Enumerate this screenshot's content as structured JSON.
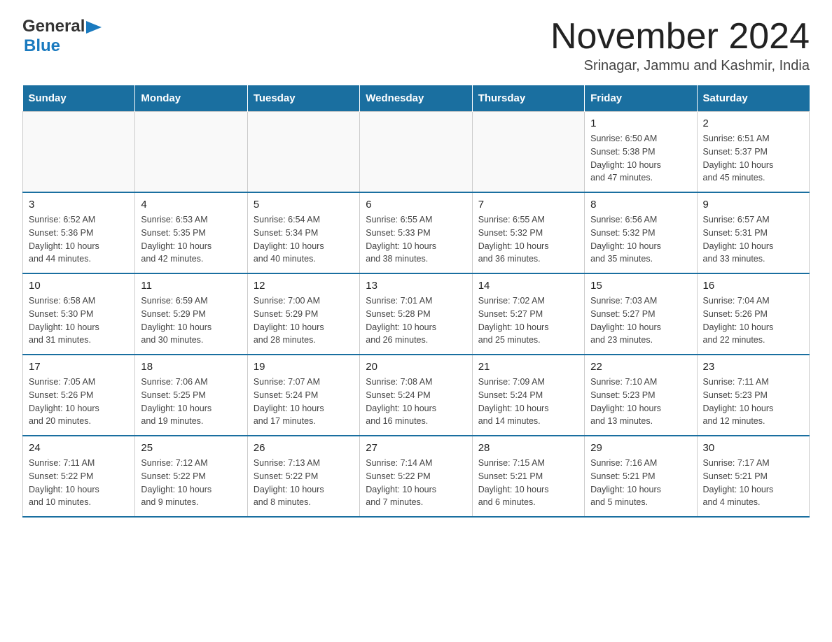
{
  "logo": {
    "general": "General",
    "triangle": "▶",
    "blue": "Blue"
  },
  "title": "November 2024",
  "location": "Srinagar, Jammu and Kashmir, India",
  "header_days": [
    "Sunday",
    "Monday",
    "Tuesday",
    "Wednesday",
    "Thursday",
    "Friday",
    "Saturday"
  ],
  "weeks": [
    [
      {
        "day": "",
        "info": ""
      },
      {
        "day": "",
        "info": ""
      },
      {
        "day": "",
        "info": ""
      },
      {
        "day": "",
        "info": ""
      },
      {
        "day": "",
        "info": ""
      },
      {
        "day": "1",
        "info": "Sunrise: 6:50 AM\nSunset: 5:38 PM\nDaylight: 10 hours\nand 47 minutes."
      },
      {
        "day": "2",
        "info": "Sunrise: 6:51 AM\nSunset: 5:37 PM\nDaylight: 10 hours\nand 45 minutes."
      }
    ],
    [
      {
        "day": "3",
        "info": "Sunrise: 6:52 AM\nSunset: 5:36 PM\nDaylight: 10 hours\nand 44 minutes."
      },
      {
        "day": "4",
        "info": "Sunrise: 6:53 AM\nSunset: 5:35 PM\nDaylight: 10 hours\nand 42 minutes."
      },
      {
        "day": "5",
        "info": "Sunrise: 6:54 AM\nSunset: 5:34 PM\nDaylight: 10 hours\nand 40 minutes."
      },
      {
        "day": "6",
        "info": "Sunrise: 6:55 AM\nSunset: 5:33 PM\nDaylight: 10 hours\nand 38 minutes."
      },
      {
        "day": "7",
        "info": "Sunrise: 6:55 AM\nSunset: 5:32 PM\nDaylight: 10 hours\nand 36 minutes."
      },
      {
        "day": "8",
        "info": "Sunrise: 6:56 AM\nSunset: 5:32 PM\nDaylight: 10 hours\nand 35 minutes."
      },
      {
        "day": "9",
        "info": "Sunrise: 6:57 AM\nSunset: 5:31 PM\nDaylight: 10 hours\nand 33 minutes."
      }
    ],
    [
      {
        "day": "10",
        "info": "Sunrise: 6:58 AM\nSunset: 5:30 PM\nDaylight: 10 hours\nand 31 minutes."
      },
      {
        "day": "11",
        "info": "Sunrise: 6:59 AM\nSunset: 5:29 PM\nDaylight: 10 hours\nand 30 minutes."
      },
      {
        "day": "12",
        "info": "Sunrise: 7:00 AM\nSunset: 5:29 PM\nDaylight: 10 hours\nand 28 minutes."
      },
      {
        "day": "13",
        "info": "Sunrise: 7:01 AM\nSunset: 5:28 PM\nDaylight: 10 hours\nand 26 minutes."
      },
      {
        "day": "14",
        "info": "Sunrise: 7:02 AM\nSunset: 5:27 PM\nDaylight: 10 hours\nand 25 minutes."
      },
      {
        "day": "15",
        "info": "Sunrise: 7:03 AM\nSunset: 5:27 PM\nDaylight: 10 hours\nand 23 minutes."
      },
      {
        "day": "16",
        "info": "Sunrise: 7:04 AM\nSunset: 5:26 PM\nDaylight: 10 hours\nand 22 minutes."
      }
    ],
    [
      {
        "day": "17",
        "info": "Sunrise: 7:05 AM\nSunset: 5:26 PM\nDaylight: 10 hours\nand 20 minutes."
      },
      {
        "day": "18",
        "info": "Sunrise: 7:06 AM\nSunset: 5:25 PM\nDaylight: 10 hours\nand 19 minutes."
      },
      {
        "day": "19",
        "info": "Sunrise: 7:07 AM\nSunset: 5:24 PM\nDaylight: 10 hours\nand 17 minutes."
      },
      {
        "day": "20",
        "info": "Sunrise: 7:08 AM\nSunset: 5:24 PM\nDaylight: 10 hours\nand 16 minutes."
      },
      {
        "day": "21",
        "info": "Sunrise: 7:09 AM\nSunset: 5:24 PM\nDaylight: 10 hours\nand 14 minutes."
      },
      {
        "day": "22",
        "info": "Sunrise: 7:10 AM\nSunset: 5:23 PM\nDaylight: 10 hours\nand 13 minutes."
      },
      {
        "day": "23",
        "info": "Sunrise: 7:11 AM\nSunset: 5:23 PM\nDaylight: 10 hours\nand 12 minutes."
      }
    ],
    [
      {
        "day": "24",
        "info": "Sunrise: 7:11 AM\nSunset: 5:22 PM\nDaylight: 10 hours\nand 10 minutes."
      },
      {
        "day": "25",
        "info": "Sunrise: 7:12 AM\nSunset: 5:22 PM\nDaylight: 10 hours\nand 9 minutes."
      },
      {
        "day": "26",
        "info": "Sunrise: 7:13 AM\nSunset: 5:22 PM\nDaylight: 10 hours\nand 8 minutes."
      },
      {
        "day": "27",
        "info": "Sunrise: 7:14 AM\nSunset: 5:22 PM\nDaylight: 10 hours\nand 7 minutes."
      },
      {
        "day": "28",
        "info": "Sunrise: 7:15 AM\nSunset: 5:21 PM\nDaylight: 10 hours\nand 6 minutes."
      },
      {
        "day": "29",
        "info": "Sunrise: 7:16 AM\nSunset: 5:21 PM\nDaylight: 10 hours\nand 5 minutes."
      },
      {
        "day": "30",
        "info": "Sunrise: 7:17 AM\nSunset: 5:21 PM\nDaylight: 10 hours\nand 4 minutes."
      }
    ]
  ]
}
